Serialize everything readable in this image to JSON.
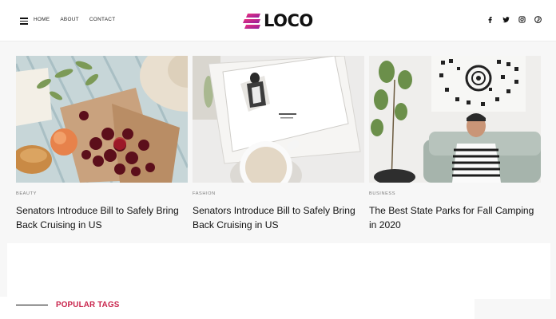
{
  "nav": {
    "items": [
      "HOME",
      "ABOUT",
      "CONTACT"
    ]
  },
  "logo": {
    "text": "LOCO",
    "accent": "#d4166f"
  },
  "social": {
    "icons": [
      "facebook-icon",
      "twitter-icon",
      "instagram-icon",
      "pinterest-icon"
    ]
  },
  "posts": [
    {
      "category": "BEAUTY",
      "title": "Senators Introduce Bill to Safely Bring Back Cruising in US"
    },
    {
      "category": "FASHION",
      "title": "Senators Introduce Bill to Safely Bring Back Cruising in US"
    },
    {
      "category": "BUSINESS",
      "title": "The Best State Parks for Fall Camping in 2020"
    }
  ],
  "sections": {
    "popular_tags": "POPULAR TAGS"
  },
  "colors": {
    "accent": "#c8224a",
    "background": "#f7f7f7"
  }
}
